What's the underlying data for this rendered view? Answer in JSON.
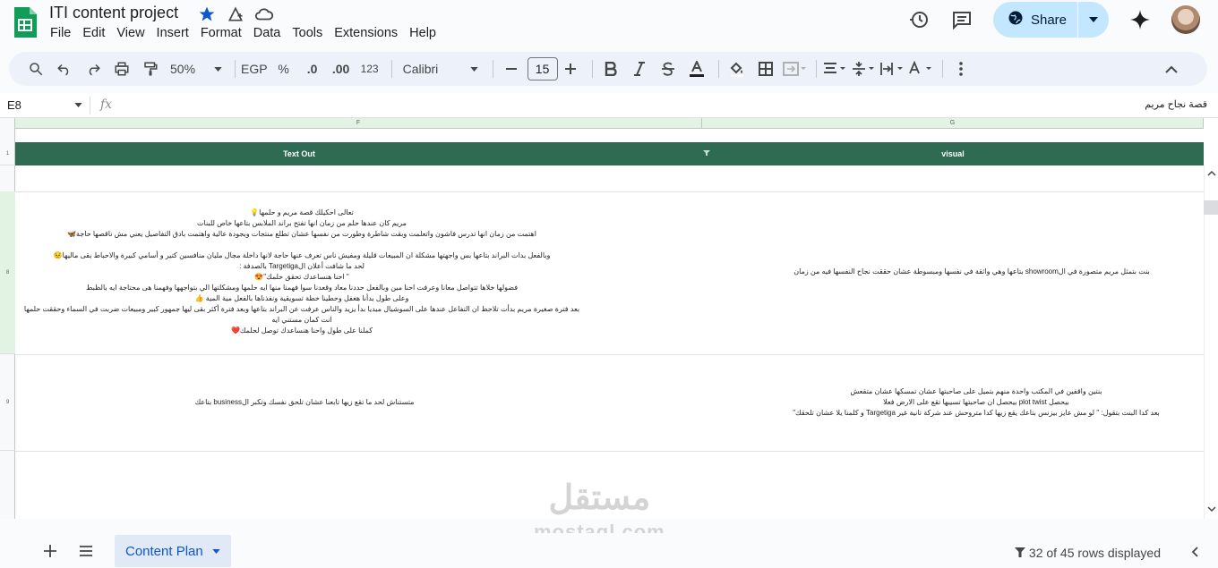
{
  "app": {
    "title": "ITI content project",
    "menus": [
      "File",
      "Edit",
      "View",
      "Insert",
      "Format",
      "Data",
      "Tools",
      "Extensions",
      "Help"
    ],
    "share_label": "Share"
  },
  "toolbar": {
    "zoom": "50%",
    "currency": "EGP",
    "percent": "%",
    "dec_decrease": ".0",
    "dec_increase": ".00",
    "number_format": "123",
    "font": "Calibri",
    "font_size": "15"
  },
  "formula_bar": {
    "cell_ref": "E8",
    "fx": "fx",
    "content": "قصة نجاح مريم"
  },
  "columns": {
    "f": "F",
    "g": "G"
  },
  "header_row": {
    "row_number": "1",
    "text_out": "Text Out",
    "visual": "visual"
  },
  "rows": [
    {
      "row_number": "8",
      "text_out": "تعالى احكيلك قصة مريم و حلمها💡\nمريم كان عندها حلم من زمان انها تفتح براند الملابس بتاعها خاص للبنات\nاهتمت من زمان انها تدرس فاشون واتعلمت وبقت شاطرة وطورت من نفسها عشان تطلع منتجات وبجودة عالية واهتمت بادق التفاصيل يعني مش ناقصها حاجة🦋\n\nوبالفعل بدات البراند بتاعها بس واجهتها مشكلة ان المبيعات قليلة ومفيش ناس تعرف عنها حاجة لانها داخلة مجال مليان منافسين كتير و أسامي كبيرة والاحباط بقى ماليها😣\nلحد ما شافت أعلان الTargetiga بالصدفة :\n\" احنا هنساعدك تحقق حلمك\"😍\nفضولها خلاها تتواصل معانا وعرفت احنا مين وبالفعل حددنا معاد وقعدنا سوا فهمنا منها ايه حلمها ومشكلتها الي بتواجهها وفهمنا هى محتاجة ايه بالظبط\nوعلى طول بدأنا هغفل وحطينا خطة تسويقية ونفذناها بالفعل مية المية 👍\nبعد فترة صغيرة مريم بدأت تلاحظ ان التفاعل عندها على السوشيال ميديا بدأ يزيد والناس عرفت عن البراند بتاعها وبعد فترة أكثر بقى ليها جمهور كبير ومبيعات ضربت في السماء وحققت حلمها\nانت كمان مستني ايه\nكملنا على طول واحنا هنساعدك توصل لحلمك❤️",
      "visual": "بنت بتمثل مريم متصورة في الshowroom بتاعها وهي واثقة في نفسها ومبسوطة عشان حققت نجاح  النفسها فيه من زمان"
    },
    {
      "row_number": "9",
      "text_out": "متستناش لحد ما تقع زيها تابعنا عشان تلحق نفسك وتكبر الbusiness بتاعك",
      "visual": "بنتين واقفين في المكتب واحدة منهم بتميل على صاحبتها عشان تمسكها عشان متقعش\nبيحصل  plot twist بيحصل ان صاحبتها تسيبها تقع على الارض فعلا\nبعد كدا البنت بتقول: \" لو مش عايز بيزنس بتاعك يقع زيها كدا متروحش عند شركة تانية غير Targetiga و كلمنا يلا عشان تلحقك\""
    }
  ],
  "bottom": {
    "sheet_tab": "Content Plan",
    "rows_displayed": "32 of 45 rows displayed"
  },
  "watermark": {
    "arabic": "مستقل",
    "latin": "mostaql.com"
  },
  "colors": {
    "header_band": "#2e6b52",
    "share_bg": "#c2e7ff",
    "toolbar_bg": "#edf2fa",
    "sheet_tab_text": "#0b57d0"
  }
}
